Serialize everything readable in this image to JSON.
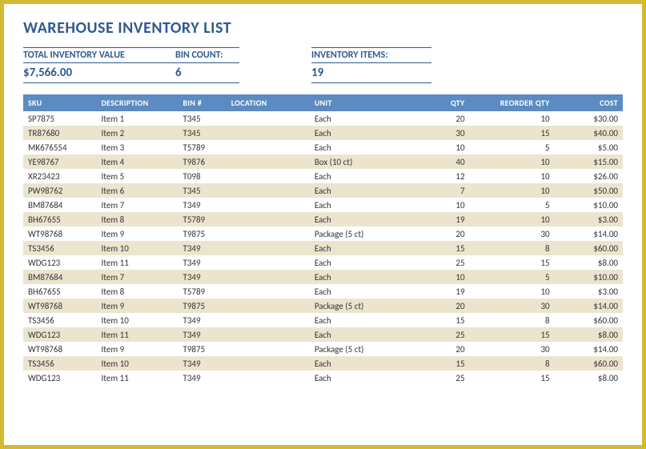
{
  "title": "WAREHOUSE INVENTORY LIST",
  "summary": {
    "total_value_label": "TOTAL INVENTORY VALUE",
    "total_value": "$7,566.00",
    "bin_count_label": "BIN COUNT:",
    "bin_count": "6",
    "items_label": "INVENTORY ITEMS:",
    "items": "19"
  },
  "columns": {
    "sku": "SKU",
    "description": "DESCRIPTION",
    "bin": "BIN #",
    "location": "LOCATION",
    "unit": "UNIT",
    "qty": "QTY",
    "reorder": "REORDER QTY",
    "cost": "COST"
  },
  "rows": [
    {
      "sku": "SP7875",
      "description": "Item 1",
      "bin": "T345",
      "location": "",
      "unit": "Each",
      "qty": "20",
      "reorder": "10",
      "cost": "$30.00"
    },
    {
      "sku": "TR87680",
      "description": "Item 2",
      "bin": "T345",
      "location": "",
      "unit": "Each",
      "qty": "30",
      "reorder": "15",
      "cost": "$40.00"
    },
    {
      "sku": "MK676554",
      "description": "Item 3",
      "bin": "T5789",
      "location": "",
      "unit": "Each",
      "qty": "10",
      "reorder": "5",
      "cost": "$5.00"
    },
    {
      "sku": "YE98767",
      "description": "Item 4",
      "bin": "T9876",
      "location": "",
      "unit": "Box (10 ct)",
      "qty": "40",
      "reorder": "10",
      "cost": "$15.00"
    },
    {
      "sku": "XR23423",
      "description": "Item 5",
      "bin": "T098",
      "location": "",
      "unit": "Each",
      "qty": "12",
      "reorder": "10",
      "cost": "$26.00"
    },
    {
      "sku": "PW98762",
      "description": "Item 6",
      "bin": "T345",
      "location": "",
      "unit": "Each",
      "qty": "7",
      "reorder": "10",
      "cost": "$50.00"
    },
    {
      "sku": "BM87684",
      "description": "Item 7",
      "bin": "T349",
      "location": "",
      "unit": "Each",
      "qty": "10",
      "reorder": "5",
      "cost": "$10.00"
    },
    {
      "sku": "BH67655",
      "description": "Item 8",
      "bin": "T5789",
      "location": "",
      "unit": "Each",
      "qty": "19",
      "reorder": "10",
      "cost": "$3.00"
    },
    {
      "sku": "WT98768",
      "description": "Item 9",
      "bin": "T9875",
      "location": "",
      "unit": "Package (5 ct)",
      "qty": "20",
      "reorder": "30",
      "cost": "$14.00"
    },
    {
      "sku": "TS3456",
      "description": "Item 10",
      "bin": "T349",
      "location": "",
      "unit": "Each",
      "qty": "15",
      "reorder": "8",
      "cost": "$60.00"
    },
    {
      "sku": "WDG123",
      "description": "Item 11",
      "bin": "T349",
      "location": "",
      "unit": "Each",
      "qty": "25",
      "reorder": "15",
      "cost": "$8.00"
    },
    {
      "sku": "BM87684",
      "description": "Item 7",
      "bin": "T349",
      "location": "",
      "unit": "Each",
      "qty": "10",
      "reorder": "5",
      "cost": "$10.00"
    },
    {
      "sku": "BH67655",
      "description": "Item 8",
      "bin": "T5789",
      "location": "",
      "unit": "Each",
      "qty": "19",
      "reorder": "10",
      "cost": "$3.00"
    },
    {
      "sku": "WT98768",
      "description": "Item 9",
      "bin": "T9875",
      "location": "",
      "unit": "Package (5 ct)",
      "qty": "20",
      "reorder": "30",
      "cost": "$14.00"
    },
    {
      "sku": "TS3456",
      "description": "Item 10",
      "bin": "T349",
      "location": "",
      "unit": "Each",
      "qty": "15",
      "reorder": "8",
      "cost": "$60.00"
    },
    {
      "sku": "WDG123",
      "description": "Item 11",
      "bin": "T349",
      "location": "",
      "unit": "Each",
      "qty": "25",
      "reorder": "15",
      "cost": "$8.00"
    },
    {
      "sku": "WT98768",
      "description": "Item 9",
      "bin": "T9875",
      "location": "",
      "unit": "Package (5 ct)",
      "qty": "20",
      "reorder": "30",
      "cost": "$14.00"
    },
    {
      "sku": "TS3456",
      "description": "Item 10",
      "bin": "T349",
      "location": "",
      "unit": "Each",
      "qty": "15",
      "reorder": "8",
      "cost": "$60.00"
    },
    {
      "sku": "WDG123",
      "description": "Item 11",
      "bin": "T349",
      "location": "",
      "unit": "Each",
      "qty": "25",
      "reorder": "15",
      "cost": "$8.00"
    }
  ]
}
